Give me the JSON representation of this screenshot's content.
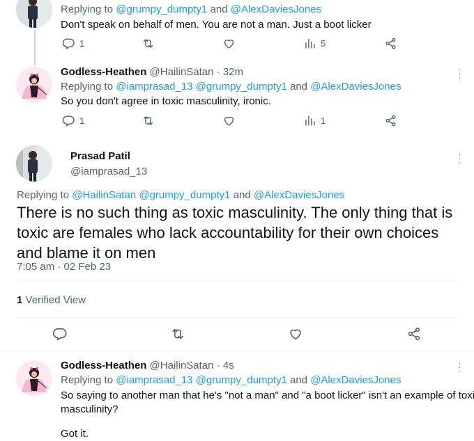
{
  "tweet1": {
    "replying_prefix": "Replying to ",
    "mention1": "@grumpy_dumpty1",
    "and": " and ",
    "mention2": "@AlexDaviesJones",
    "text": "Don't speak on behalf of men. You are not a man. Just a boot licker",
    "reply_count": "1",
    "views_count": "5"
  },
  "tweet2": {
    "name": "Godless-Heathen",
    "handle": "@HailinSatan",
    "time": "· 32m",
    "replying_prefix": "Replying to ",
    "mention1": "@iamprasad_13",
    "mention2": "@grumpy_dumpty1",
    "and": " and ",
    "mention3": "@AlexDaviesJones",
    "text": "So you don't agree in toxic masculinity, ironic.",
    "reply_count": "1",
    "views_count": "1"
  },
  "main_tweet": {
    "name": "Prasad Patil",
    "handle": "@iamprasad_13",
    "replying_prefix": "Replying to ",
    "mention1": "@HailinSatan",
    "mention2": "@grumpy_dumpty1",
    "and": " and ",
    "mention3": "@AlexDaviesJones",
    "text": "There is no such thing as toxic masculinity. The only thing that is toxic are females who lack accountability for their own choices and blame it on men",
    "timestamp": "7:05 am · 02 Feb 23",
    "verified_count": "1",
    "verified_label": " Verified View"
  },
  "tweet3": {
    "name": "Godless-Heathen",
    "handle": "@HailinSatan",
    "time": "· 4s",
    "replying_prefix": "Replying to ",
    "mention1": "@iamprasad_13",
    "mention2": "@grumpy_dumpty1",
    "and": " and ",
    "mention3": "@AlexDaviesJones",
    "text_line1": "So saying to another man that he's \"not a man\" and \"a boot licker\" isn't an example of toxic",
    "text_line2": "masculinity?",
    "text_line3": "Got it."
  },
  "colors": {
    "link": "#1d9bf0",
    "muted": "#536471",
    "divider": "#eff3f4",
    "thread_line": "#cfd9de"
  },
  "icons": [
    "reply-icon",
    "retweet-icon",
    "like-icon",
    "views-icon",
    "share-icon",
    "more-icon"
  ]
}
